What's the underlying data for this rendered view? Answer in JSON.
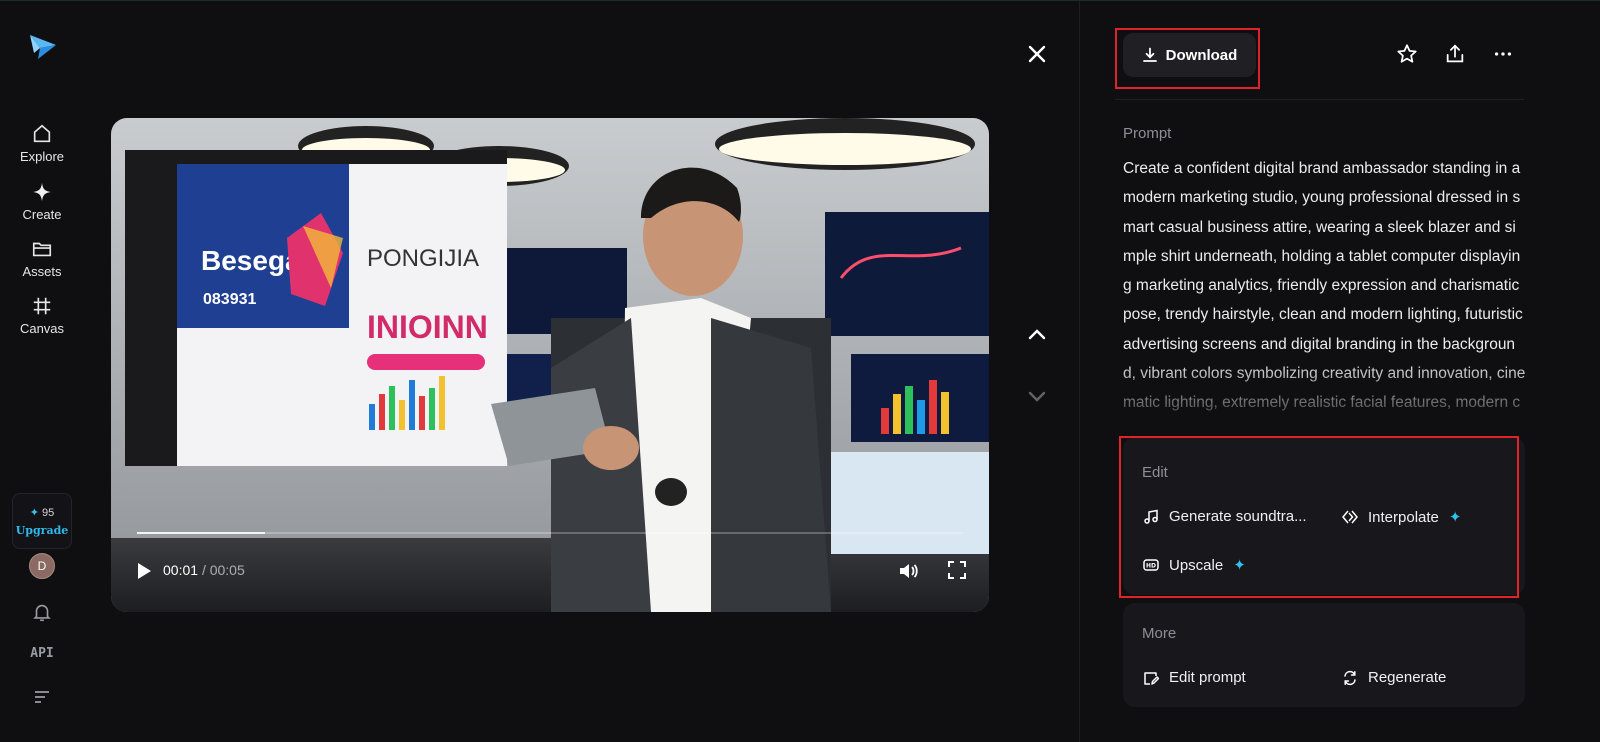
{
  "nav": {
    "items": [
      {
        "label": "Explore",
        "icon": "home-icon"
      },
      {
        "label": "Create",
        "icon": "sparkle-icon"
      },
      {
        "label": "Assets",
        "icon": "folder-icon"
      },
      {
        "label": "Canvas",
        "icon": "frame-grid-icon"
      }
    ],
    "credits": "95",
    "upgrade_label": "Upgrade",
    "avatar_initial": "D",
    "api_label": "API"
  },
  "player": {
    "current_time": "00:01",
    "duration": "/ 00:05",
    "progress": 0.155
  },
  "panel": {
    "download_label": "Download",
    "prompt_heading": "Prompt",
    "prompt_text": "Create a confident digital brand ambassador standing in a modern marketing studio, young professional dressed in smart casual business attire, wearing a sleek blazer and simple shirt underneath, holding a tablet computer displaying marketing analytics, friendly expression and charismatic pose, trendy hairstyle, clean and modern lighting, futuristic advertising screens and digital branding in the background, vibrant colors symbolizing creativity and innovation, cinematic lighting, extremely realistic facial features, modern corporate style, ultra-detailed, professio",
    "edit_heading": "Edit",
    "edit_actions": [
      {
        "label": "Generate soundtra...",
        "icon": "music-note-icon",
        "premium": false
      },
      {
        "label": "Interpolate",
        "icon": "interpolate-icon",
        "premium": true
      },
      {
        "label": "Upscale",
        "icon": "hd-icon",
        "premium": true
      }
    ],
    "more_heading": "More",
    "more_actions": [
      {
        "label": "Edit prompt",
        "icon": "edit-prompt-icon"
      },
      {
        "label": "Regenerate",
        "icon": "regenerate-icon"
      }
    ]
  },
  "colors": {
    "accent": "#2fc2ef",
    "highlight": "#e0232b",
    "background": "#0f0f11",
    "card": "#18181c"
  }
}
